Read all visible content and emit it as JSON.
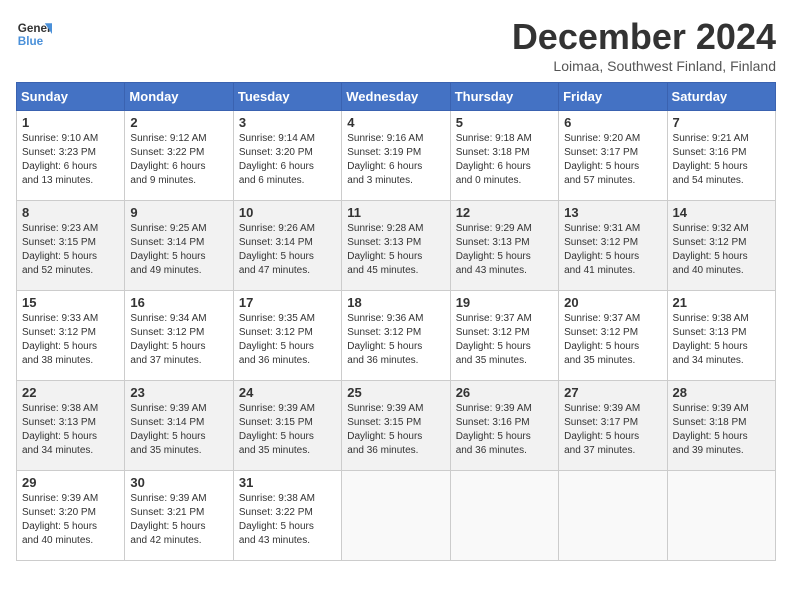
{
  "header": {
    "logo_general": "General",
    "logo_blue": "Blue",
    "title": "December 2024",
    "location": "Loimaa, Southwest Finland, Finland"
  },
  "calendar": {
    "weekdays": [
      "Sunday",
      "Monday",
      "Tuesday",
      "Wednesday",
      "Thursday",
      "Friday",
      "Saturday"
    ],
    "weeks": [
      [
        {
          "day": "1",
          "info": "Sunrise: 9:10 AM\nSunset: 3:23 PM\nDaylight: 6 hours\nand 13 minutes."
        },
        {
          "day": "2",
          "info": "Sunrise: 9:12 AM\nSunset: 3:22 PM\nDaylight: 6 hours\nand 9 minutes."
        },
        {
          "day": "3",
          "info": "Sunrise: 9:14 AM\nSunset: 3:20 PM\nDaylight: 6 hours\nand 6 minutes."
        },
        {
          "day": "4",
          "info": "Sunrise: 9:16 AM\nSunset: 3:19 PM\nDaylight: 6 hours\nand 3 minutes."
        },
        {
          "day": "5",
          "info": "Sunrise: 9:18 AM\nSunset: 3:18 PM\nDaylight: 6 hours\nand 0 minutes."
        },
        {
          "day": "6",
          "info": "Sunrise: 9:20 AM\nSunset: 3:17 PM\nDaylight: 5 hours\nand 57 minutes."
        },
        {
          "day": "7",
          "info": "Sunrise: 9:21 AM\nSunset: 3:16 PM\nDaylight: 5 hours\nand 54 minutes."
        }
      ],
      [
        {
          "day": "8",
          "info": "Sunrise: 9:23 AM\nSunset: 3:15 PM\nDaylight: 5 hours\nand 52 minutes."
        },
        {
          "day": "9",
          "info": "Sunrise: 9:25 AM\nSunset: 3:14 PM\nDaylight: 5 hours\nand 49 minutes."
        },
        {
          "day": "10",
          "info": "Sunrise: 9:26 AM\nSunset: 3:14 PM\nDaylight: 5 hours\nand 47 minutes."
        },
        {
          "day": "11",
          "info": "Sunrise: 9:28 AM\nSunset: 3:13 PM\nDaylight: 5 hours\nand 45 minutes."
        },
        {
          "day": "12",
          "info": "Sunrise: 9:29 AM\nSunset: 3:13 PM\nDaylight: 5 hours\nand 43 minutes."
        },
        {
          "day": "13",
          "info": "Sunrise: 9:31 AM\nSunset: 3:12 PM\nDaylight: 5 hours\nand 41 minutes."
        },
        {
          "day": "14",
          "info": "Sunrise: 9:32 AM\nSunset: 3:12 PM\nDaylight: 5 hours\nand 40 minutes."
        }
      ],
      [
        {
          "day": "15",
          "info": "Sunrise: 9:33 AM\nSunset: 3:12 PM\nDaylight: 5 hours\nand 38 minutes."
        },
        {
          "day": "16",
          "info": "Sunrise: 9:34 AM\nSunset: 3:12 PM\nDaylight: 5 hours\nand 37 minutes."
        },
        {
          "day": "17",
          "info": "Sunrise: 9:35 AM\nSunset: 3:12 PM\nDaylight: 5 hours\nand 36 minutes."
        },
        {
          "day": "18",
          "info": "Sunrise: 9:36 AM\nSunset: 3:12 PM\nDaylight: 5 hours\nand 36 minutes."
        },
        {
          "day": "19",
          "info": "Sunrise: 9:37 AM\nSunset: 3:12 PM\nDaylight: 5 hours\nand 35 minutes."
        },
        {
          "day": "20",
          "info": "Sunrise: 9:37 AM\nSunset: 3:12 PM\nDaylight: 5 hours\nand 35 minutes."
        },
        {
          "day": "21",
          "info": "Sunrise: 9:38 AM\nSunset: 3:13 PM\nDaylight: 5 hours\nand 34 minutes."
        }
      ],
      [
        {
          "day": "22",
          "info": "Sunrise: 9:38 AM\nSunset: 3:13 PM\nDaylight: 5 hours\nand 34 minutes."
        },
        {
          "day": "23",
          "info": "Sunrise: 9:39 AM\nSunset: 3:14 PM\nDaylight: 5 hours\nand 35 minutes."
        },
        {
          "day": "24",
          "info": "Sunrise: 9:39 AM\nSunset: 3:15 PM\nDaylight: 5 hours\nand 35 minutes."
        },
        {
          "day": "25",
          "info": "Sunrise: 9:39 AM\nSunset: 3:15 PM\nDaylight: 5 hours\nand 36 minutes."
        },
        {
          "day": "26",
          "info": "Sunrise: 9:39 AM\nSunset: 3:16 PM\nDaylight: 5 hours\nand 36 minutes."
        },
        {
          "day": "27",
          "info": "Sunrise: 9:39 AM\nSunset: 3:17 PM\nDaylight: 5 hours\nand 37 minutes."
        },
        {
          "day": "28",
          "info": "Sunrise: 9:39 AM\nSunset: 3:18 PM\nDaylight: 5 hours\nand 39 minutes."
        }
      ],
      [
        {
          "day": "29",
          "info": "Sunrise: 9:39 AM\nSunset: 3:20 PM\nDaylight: 5 hours\nand 40 minutes."
        },
        {
          "day": "30",
          "info": "Sunrise: 9:39 AM\nSunset: 3:21 PM\nDaylight: 5 hours\nand 42 minutes."
        },
        {
          "day": "31",
          "info": "Sunrise: 9:38 AM\nSunset: 3:22 PM\nDaylight: 5 hours\nand 43 minutes."
        },
        {
          "day": "",
          "info": ""
        },
        {
          "day": "",
          "info": ""
        },
        {
          "day": "",
          "info": ""
        },
        {
          "day": "",
          "info": ""
        }
      ]
    ]
  }
}
